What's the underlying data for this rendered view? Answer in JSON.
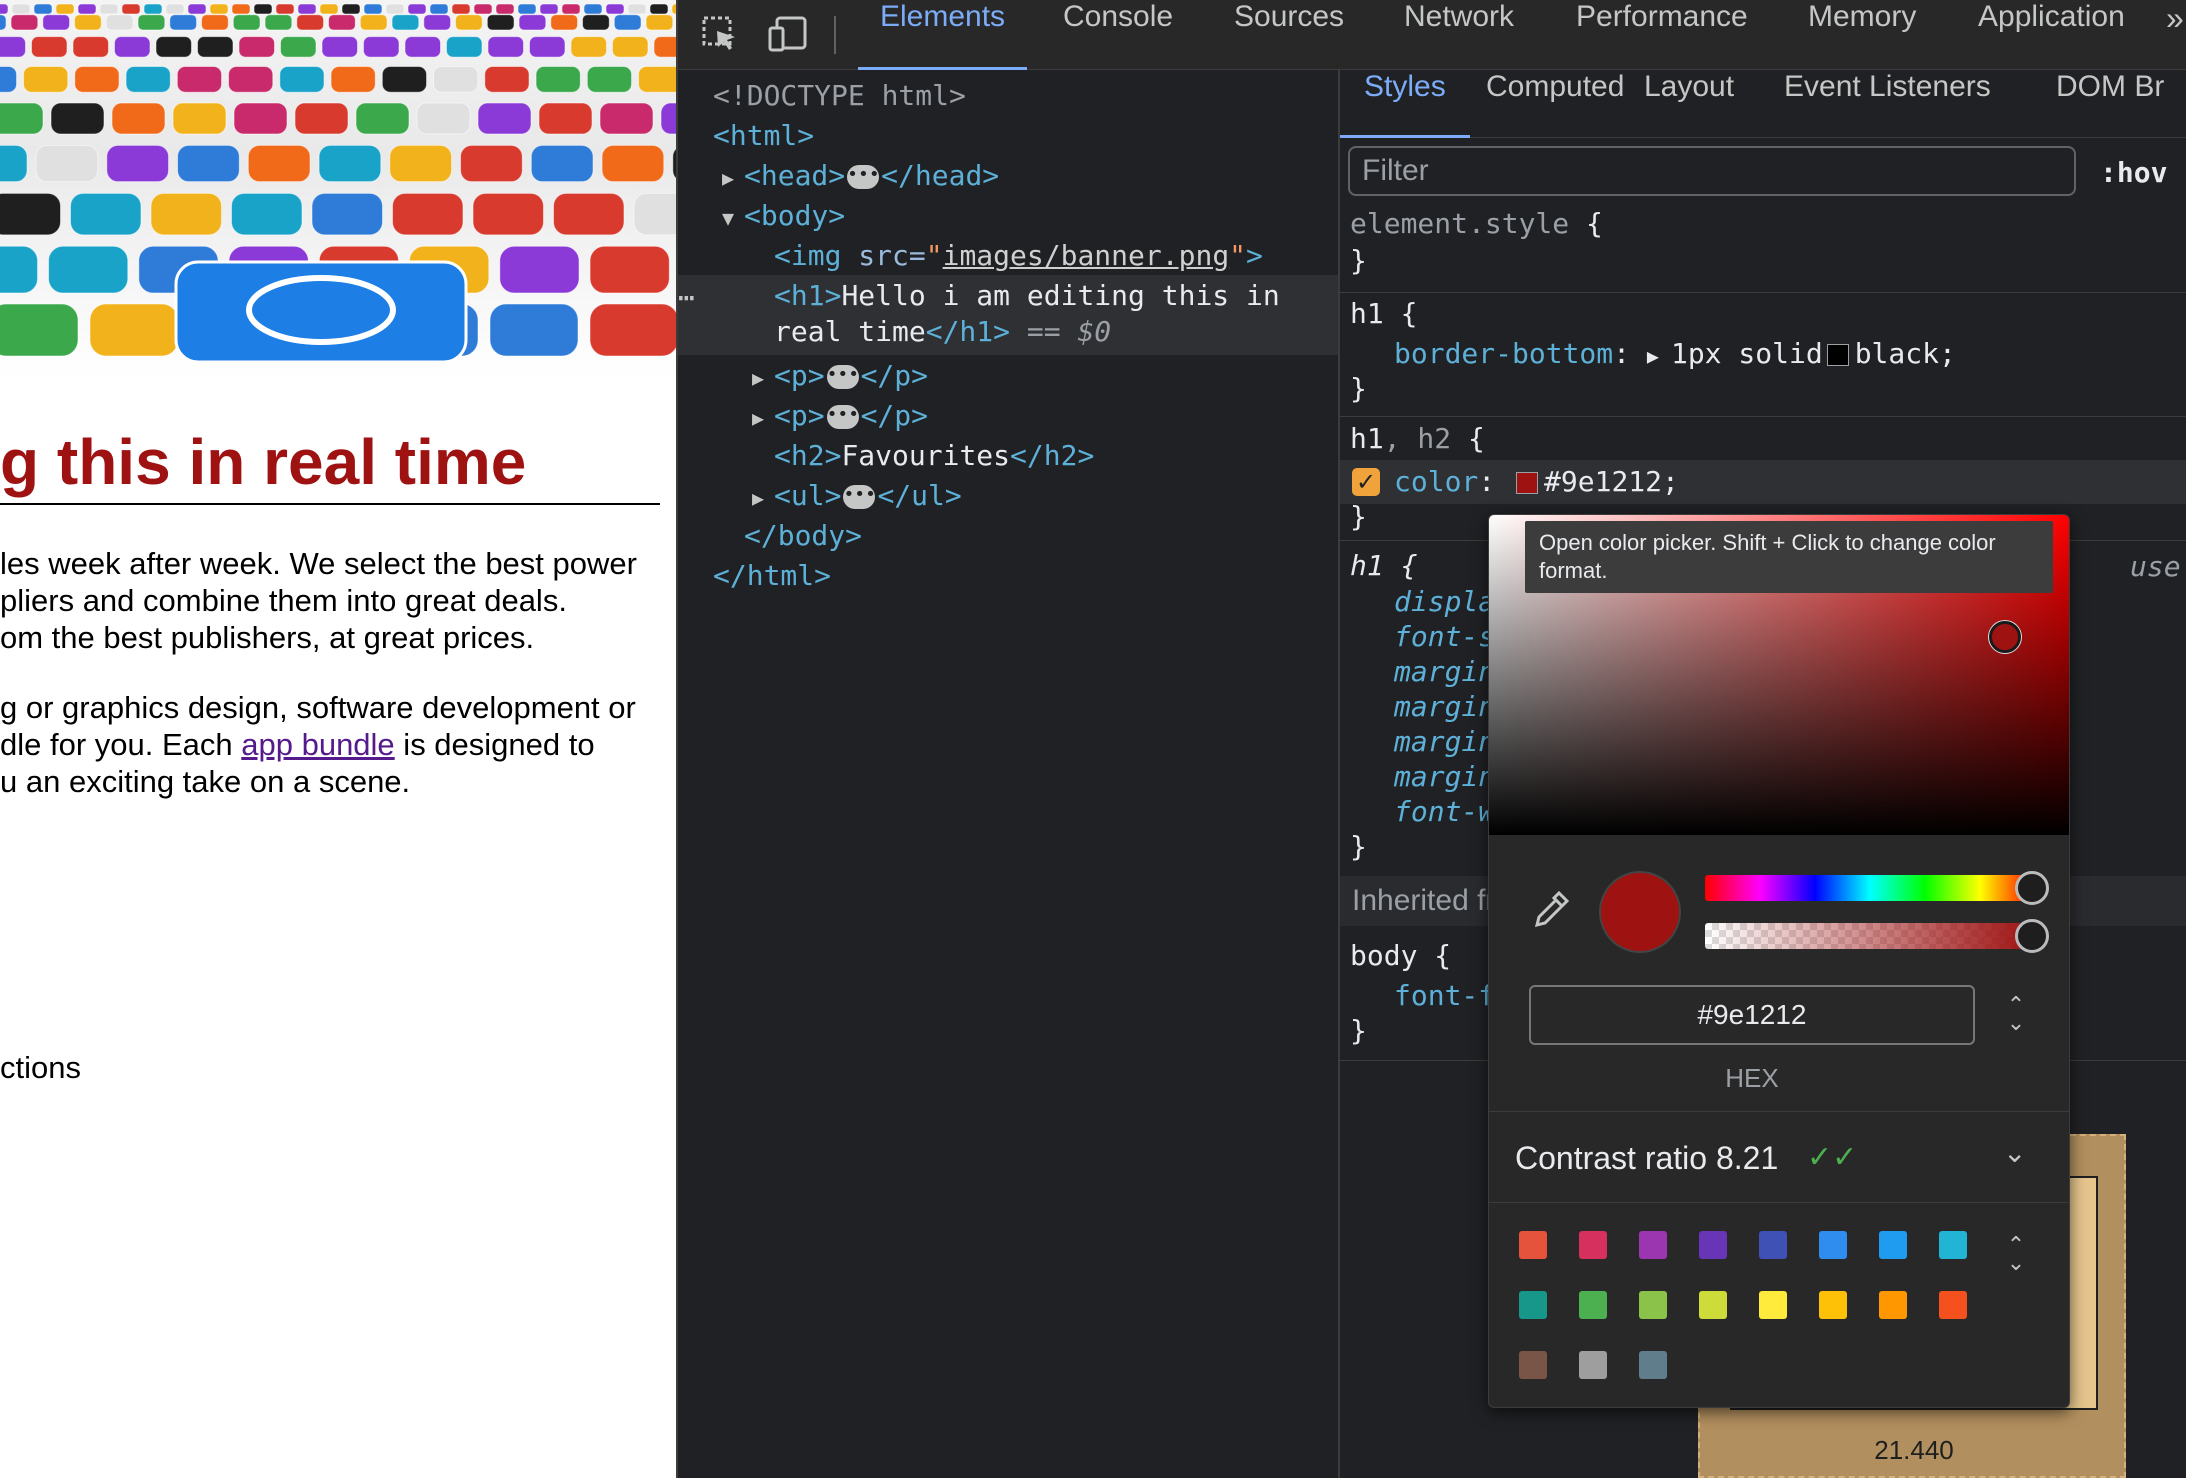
{
  "page": {
    "h1": "g this in real time",
    "para1": [
      "les week after week. We select the best power",
      "pliers and combine them into great deals.",
      "om the best publishers, at great prices."
    ],
    "para2_line1": "g or graphics design, software development or",
    "para2_line2_pre": "dle for you. Each ",
    "para2_link": "app bundle",
    "para2_line2_post": " is designed to",
    "para2_line3": "u an exciting take on a scene.",
    "list_fragment": "ctions"
  },
  "devtools": {
    "tabs": [
      "Elements",
      "Console",
      "Sources",
      "Network",
      "Performance",
      "Memory",
      "Application"
    ],
    "active_tab": "Elements",
    "more_tabs": "»",
    "dom": {
      "doctype": "<!DOCTYPE html>",
      "html_open": "<html>",
      "head_open": "<head>",
      "head_close": "</head>",
      "body_open": "<body>",
      "img_tag": "<img",
      "img_attr": " src=",
      "img_src": "images/banner.png",
      "h1_open": "<h1>",
      "h1_text_1": "Hello i am editing this in",
      "h1_text_2": "real time",
      "h1_close": "</h1>",
      "selected_marker": " == ",
      "selected_var": "$0",
      "p_open": "<p>",
      "p_close": "</p>",
      "h2_open": "<h2>",
      "h2_text": "Favourites",
      "h2_close": "</h2>",
      "ul_open": "<ul>",
      "ul_close": "</ul>",
      "body_close": "</body>",
      "html_close": "</html>",
      "row_dots": "⋯"
    },
    "styles": {
      "subtabs": [
        "Styles",
        "Computed",
        "Layout",
        "Event Listeners",
        "DOM Br"
      ],
      "active_subtab": "Styles",
      "filter_placeholder": "Filter",
      "hov": ":hov",
      "element_style": "element.style",
      "rule1_selector": "h1",
      "rule1_prop": "border-bottom",
      "rule1_value_pre": "1px solid",
      "rule1_value_color": "black;",
      "rule2_selector_main": "h1",
      "rule2_selector_dim": ", h2",
      "rule2_prop": "color",
      "rule2_value": "#9e1212;",
      "rule3_selector": "h1",
      "rule3_props": [
        "displa",
        "font-s",
        "margin",
        "margin",
        "margin",
        "margin",
        "font-w"
      ],
      "user_agent": "use",
      "inherited": "Inherited fr",
      "body_selector": "body",
      "body_prop": "font-f",
      "open_brace": " {",
      "close_brace": "}",
      "box_model_value": "21.440"
    },
    "picker": {
      "tooltip": "Open color picker. Shift + Click to change color format.",
      "hex_value": "#9e1212",
      "format_label": "HEX",
      "contrast_label": "Contrast ratio",
      "contrast_value": "8.21",
      "palette": [
        "#e5533d",
        "#d6305f",
        "#9c35b0",
        "#6735b6",
        "#3f51b5",
        "#2f8df0",
        "#1f9bf0",
        "#22b4d4",
        "#16978a",
        "#4caf50",
        "#8bc34a",
        "#cddc39",
        "#ffeb3b",
        "#ffc107",
        "#ff9800",
        "#f4511e",
        "#795548",
        "#9e9e9e",
        "#607d8b"
      ]
    }
  },
  "colors": {
    "accent": "#7cacf8",
    "h1_color": "#9e1212",
    "checkbox": "#f0a33a"
  }
}
